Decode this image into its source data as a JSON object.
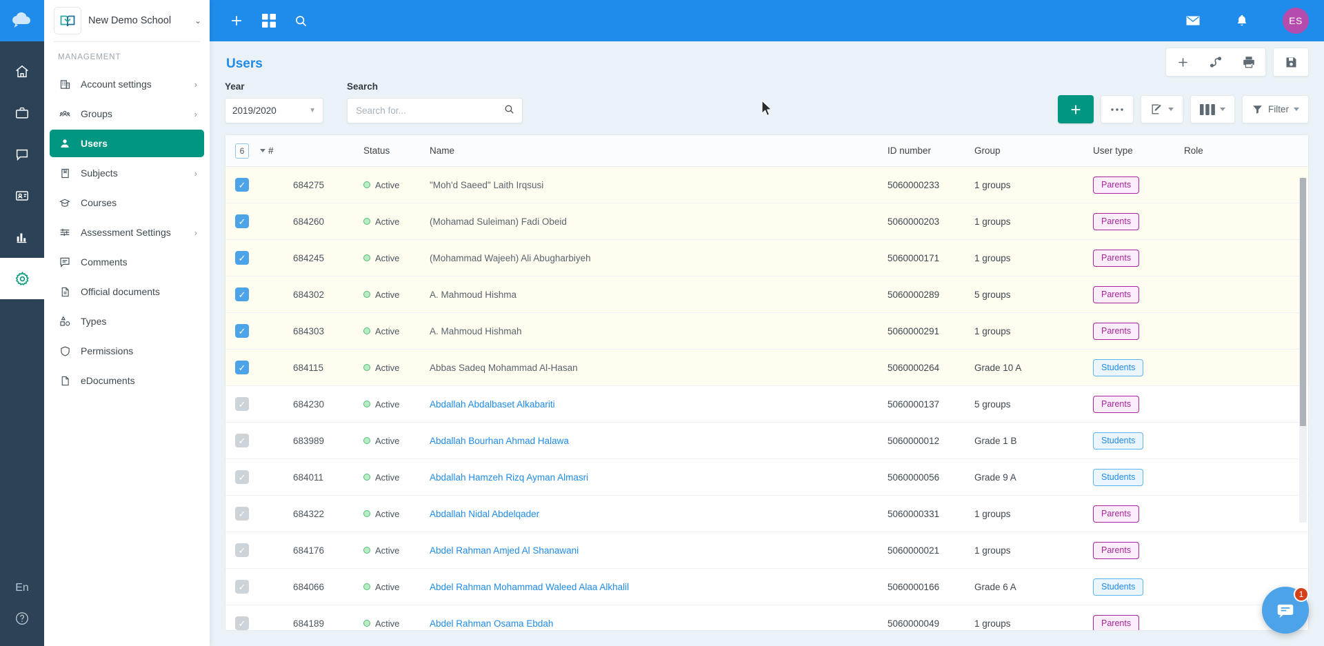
{
  "rail": {
    "logo_icon": "cloud-logo-icon",
    "items": [
      {
        "icon": "home-icon",
        "name": "home",
        "active": false
      },
      {
        "icon": "briefcase-icon",
        "name": "work",
        "active": false
      },
      {
        "icon": "chat-icon",
        "name": "messages",
        "active": false
      },
      {
        "icon": "id-card-icon",
        "name": "contacts",
        "active": false
      },
      {
        "icon": "bar-chart-icon",
        "name": "reports",
        "active": false
      },
      {
        "icon": "gear-icon",
        "name": "settings",
        "active": true
      }
    ],
    "language": "En",
    "help_icon": "help-circle-icon"
  },
  "sidebar": {
    "school_name": "New Demo School",
    "section_label": "MANAGEMENT",
    "items": [
      {
        "label": "Account settings",
        "icon": "building-icon",
        "expandable": true,
        "active": false
      },
      {
        "label": "Groups",
        "icon": "group-icon",
        "expandable": true,
        "active": false
      },
      {
        "label": "Users",
        "icon": "user-icon",
        "expandable": false,
        "active": true
      },
      {
        "label": "Subjects",
        "icon": "book-icon",
        "expandable": true,
        "active": false
      },
      {
        "label": "Courses",
        "icon": "graduation-cap-icon",
        "expandable": false,
        "active": false
      },
      {
        "label": "Assessment Settings",
        "icon": "sliders-icon",
        "expandable": true,
        "active": false
      },
      {
        "label": "Comments",
        "icon": "comment-icon",
        "expandable": false,
        "active": false
      },
      {
        "label": "Official documents",
        "icon": "document-icon",
        "expandable": false,
        "active": false
      },
      {
        "label": "Types",
        "icon": "shapes-icon",
        "expandable": false,
        "active": false
      },
      {
        "label": "Permissions",
        "icon": "shield-icon",
        "expandable": false,
        "active": false
      },
      {
        "label": "eDocuments",
        "icon": "file-icon",
        "expandable": false,
        "active": false
      }
    ]
  },
  "topbar": {
    "add_icon": "plus-icon",
    "apps_icon": "grid-icon",
    "search_icon": "search-icon",
    "mail_icon": "envelope-icon",
    "bell_icon": "bell-icon",
    "avatar_initials": "ES",
    "avatar_color": "#b54cad",
    "background_color": "#1f8bea"
  },
  "page": {
    "title": "Users",
    "year_label": "Year",
    "year_value": "2019/2020",
    "search_label": "Search",
    "search_placeholder": "Search for...",
    "search_value": ""
  },
  "toolbar_top": {
    "add_icon": "plus-icon",
    "share_icon": "share-nodes-icon",
    "print_icon": "print-icon",
    "save_icon": "floppy-save-icon"
  },
  "toolbar_row": {
    "add_label": "",
    "add_icon": "plus-icon",
    "more_icon": "ellipsis-icon",
    "edit_icon": "edit-square-icon",
    "columns_icon": "columns-icon",
    "filter_label": "Filter",
    "filter_icon": "funnel-icon"
  },
  "table": {
    "selected_count": "6",
    "columns": [
      "#",
      "Status",
      "Name",
      "ID number",
      "Group",
      "User type",
      "Role"
    ],
    "rows": [
      {
        "checked": true,
        "num": "684275",
        "status": "Active",
        "name": "\"Moh'd Saeed\" Laith Irqsusi",
        "id_number": "5060000233",
        "group": "1 groups",
        "user_type": "Parents",
        "role": ""
      },
      {
        "checked": true,
        "num": "684260",
        "status": "Active",
        "name": "(Mohamad Suleiman) Fadi Obeid",
        "id_number": "5060000203",
        "group": "1 groups",
        "user_type": "Parents",
        "role": ""
      },
      {
        "checked": true,
        "num": "684245",
        "status": "Active",
        "name": "(Mohammad Wajeeh) Ali Abugharbiyeh",
        "id_number": "5060000171",
        "group": "1 groups",
        "user_type": "Parents",
        "role": ""
      },
      {
        "checked": true,
        "num": "684302",
        "status": "Active",
        "name": "A. Mahmoud Hishma",
        "id_number": "5060000289",
        "group": "5 groups",
        "user_type": "Parents",
        "role": ""
      },
      {
        "checked": true,
        "num": "684303",
        "status": "Active",
        "name": "A. Mahmoud Hishmah",
        "id_number": "5060000291",
        "group": "1 groups",
        "user_type": "Parents",
        "role": ""
      },
      {
        "checked": true,
        "num": "684115",
        "status": "Active",
        "name": "Abbas Sadeq Mohammad Al-Hasan",
        "id_number": "5060000264",
        "group": "Grade 10 A",
        "user_type": "Students",
        "role": ""
      },
      {
        "checked": false,
        "num": "684230",
        "status": "Active",
        "name": "Abdallah Abdalbaset Alkabariti",
        "id_number": "5060000137",
        "group": "5 groups",
        "user_type": "Parents",
        "role": ""
      },
      {
        "checked": false,
        "num": "683989",
        "status": "Active",
        "name": "Abdallah Bourhan Ahmad Halawa",
        "id_number": "5060000012",
        "group": "Grade 1 B",
        "user_type": "Students",
        "role": ""
      },
      {
        "checked": false,
        "num": "684011",
        "status": "Active",
        "name": "Abdallah Hamzeh Rizq Ayman Almasri",
        "id_number": "5060000056",
        "group": "Grade 9 A",
        "user_type": "Students",
        "role": ""
      },
      {
        "checked": false,
        "num": "684322",
        "status": "Active",
        "name": "Abdallah Nidal Abdelqader",
        "id_number": "5060000331",
        "group": "1 groups",
        "user_type": "Parents",
        "role": ""
      },
      {
        "checked": false,
        "num": "684176",
        "status": "Active",
        "name": "Abdel Rahman Amjed Al Shanawani",
        "id_number": "5060000021",
        "group": "1 groups",
        "user_type": "Parents",
        "role": ""
      },
      {
        "checked": false,
        "num": "684066",
        "status": "Active",
        "name": "Abdel Rahman Mohammad Waleed Alaa Alkhalil",
        "id_number": "5060000166",
        "group": "Grade 6 A",
        "user_type": "Students",
        "role": ""
      },
      {
        "checked": false,
        "num": "684189",
        "status": "Active",
        "name": "Abdel Rahman Osama Ebdah",
        "id_number": "5060000049",
        "group": "1 groups",
        "user_type": "Parents",
        "role": ""
      }
    ]
  },
  "chat": {
    "icon": "chat-bubble-icon",
    "unread": "1",
    "color": "#4da3e8"
  },
  "colors": {
    "accent_blue": "#1f8bea",
    "accent_teal": "#009682",
    "sidebar_dark": "#2b4257",
    "selected_row": "#fffdf0"
  }
}
